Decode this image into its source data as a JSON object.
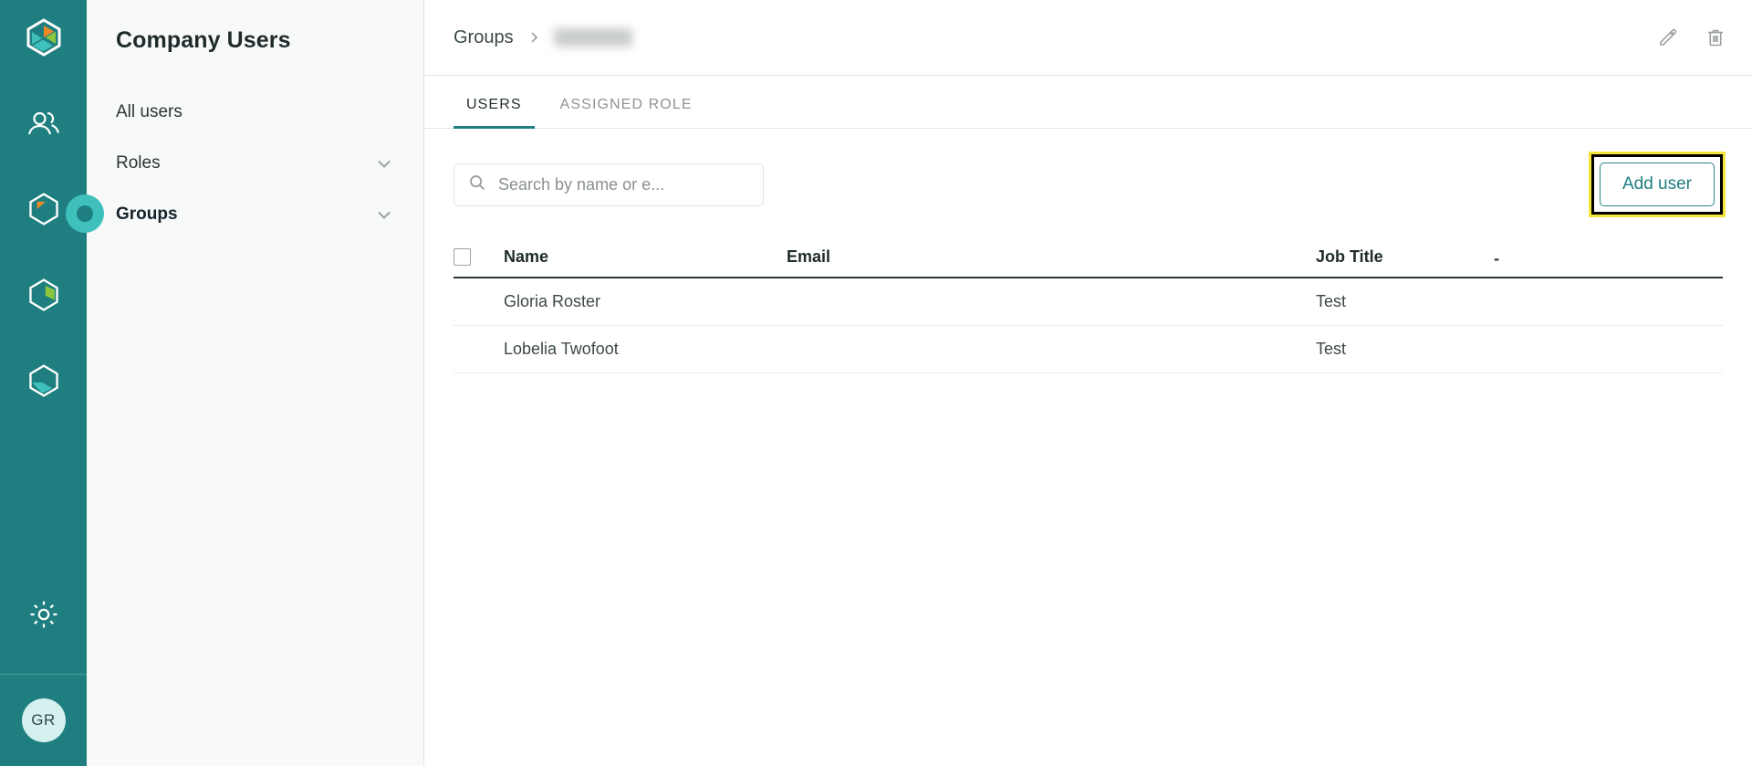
{
  "rail": {
    "logo_name": "cube-logo",
    "items": [
      {
        "name": "users-icon",
        "label": "Users"
      },
      {
        "name": "cube-orange-icon",
        "label": "Products"
      },
      {
        "name": "cube-green-icon",
        "label": "Assets"
      },
      {
        "name": "cube-teal-icon",
        "label": "Services"
      }
    ],
    "settings_label": "Settings",
    "avatar_initials": "GR"
  },
  "subnav": {
    "title": "Company Users",
    "items": [
      {
        "label": "All users",
        "has_chevron": false,
        "active": false
      },
      {
        "label": "Roles",
        "has_chevron": true,
        "active": false
      },
      {
        "label": "Groups",
        "has_chevron": true,
        "active": true
      }
    ]
  },
  "topbar": {
    "breadcrumb": {
      "root": "Groups",
      "separator": "›",
      "current": ""
    },
    "edit_label": "Edit",
    "delete_label": "Delete"
  },
  "tabs": [
    {
      "label": "USERS",
      "active": true
    },
    {
      "label": "ASSIGNED ROLE",
      "active": false
    }
  ],
  "toolbar": {
    "search_placeholder": "Search by name or e...",
    "search_value": "",
    "add_user_label": "Add user"
  },
  "table": {
    "columns": [
      "Name",
      "Email",
      "Job Title"
    ],
    "sort_mark": "-",
    "rows": [
      {
        "name": "Gloria Roster",
        "email": "",
        "job_title": "Test"
      },
      {
        "name": "Lobelia Twofoot",
        "email": "",
        "job_title": "Test"
      }
    ]
  },
  "colors": {
    "brand_teal": "#1f7f80",
    "accent_teal": "#3fc0bd",
    "highlight_yellow": "#f5e53b",
    "sidebar_bg": "#f8f9f9"
  }
}
